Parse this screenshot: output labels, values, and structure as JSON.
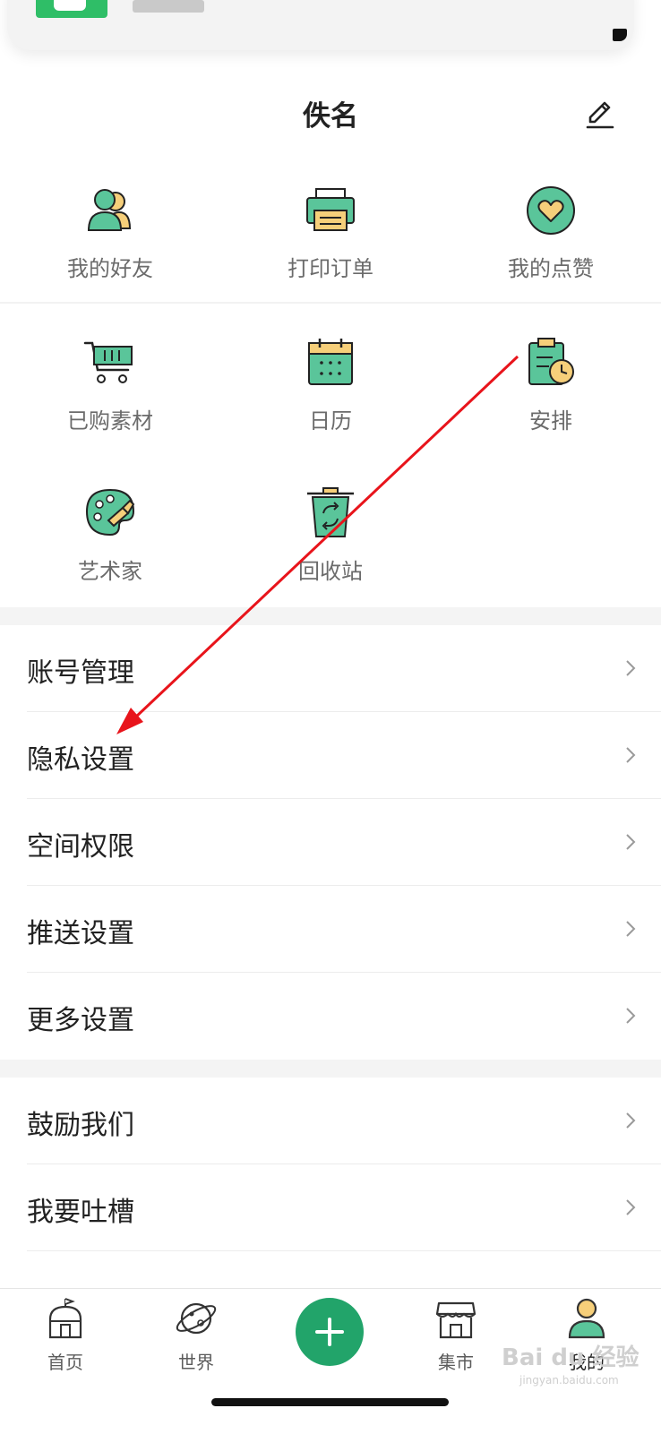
{
  "profile": {
    "nickname": "佚名"
  },
  "colors": {
    "accent": "#22a46a",
    "icon_green": "#5ac59a",
    "icon_yellow": "#f6cf7a",
    "arrow": "#e8141b"
  },
  "grid": [
    {
      "label": "我的好友",
      "icon": "friends-icon"
    },
    {
      "label": "打印订单",
      "icon": "printer-icon"
    },
    {
      "label": "我的点赞",
      "icon": "heart-icon"
    },
    {
      "label": "已购素材",
      "icon": "cart-icon"
    },
    {
      "label": "日历",
      "icon": "calendar-icon"
    },
    {
      "label": "安排",
      "icon": "schedule-icon"
    },
    {
      "label": "艺术家",
      "icon": "palette-icon"
    },
    {
      "label": "回收站",
      "icon": "recycle-bin-icon"
    }
  ],
  "menu1": [
    {
      "label": "账号管理"
    },
    {
      "label": "隐私设置"
    },
    {
      "label": "空间权限"
    },
    {
      "label": "推送设置"
    },
    {
      "label": "更多设置"
    }
  ],
  "menu2": [
    {
      "label": "鼓励我们"
    },
    {
      "label": "我要吐槽"
    }
  ],
  "tabs": [
    {
      "label": "首页",
      "icon": "home-icon"
    },
    {
      "label": "世界",
      "icon": "planet-icon"
    },
    {
      "label": "",
      "icon": "plus-icon"
    },
    {
      "label": "集市",
      "icon": "store-icon"
    },
    {
      "label": "我的",
      "icon": "profile-icon"
    }
  ],
  "watermark": {
    "main": "Bai du 经验",
    "sub": "jingyan.baidu.com"
  }
}
